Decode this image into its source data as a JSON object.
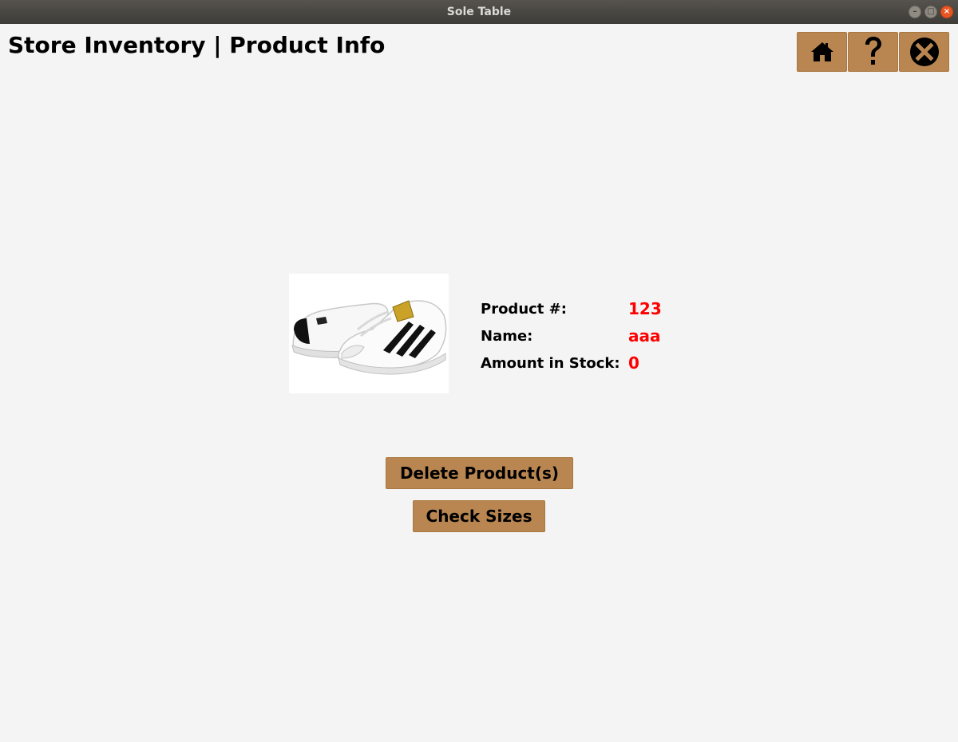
{
  "window": {
    "title": "Sole Table"
  },
  "header": {
    "title": "Store Inventory | Product Info"
  },
  "toolbar": {
    "buttons": [
      {
        "icon": "home-icon"
      },
      {
        "icon": "help-icon"
      },
      {
        "icon": "close-circle-icon"
      }
    ]
  },
  "product": {
    "image": "sneaker-image",
    "fields": [
      {
        "label": "Product #:",
        "value": "123"
      },
      {
        "label": "Name:",
        "value": "aaa"
      },
      {
        "label": "Amount in Stock:",
        "value": "0"
      }
    ]
  },
  "actions": {
    "delete_label": "Delete Product(s)",
    "sizes_label": "Check Sizes"
  },
  "colors": {
    "button": "#b98651",
    "value_text": "#ff0000",
    "background": "#f4f4f4"
  }
}
